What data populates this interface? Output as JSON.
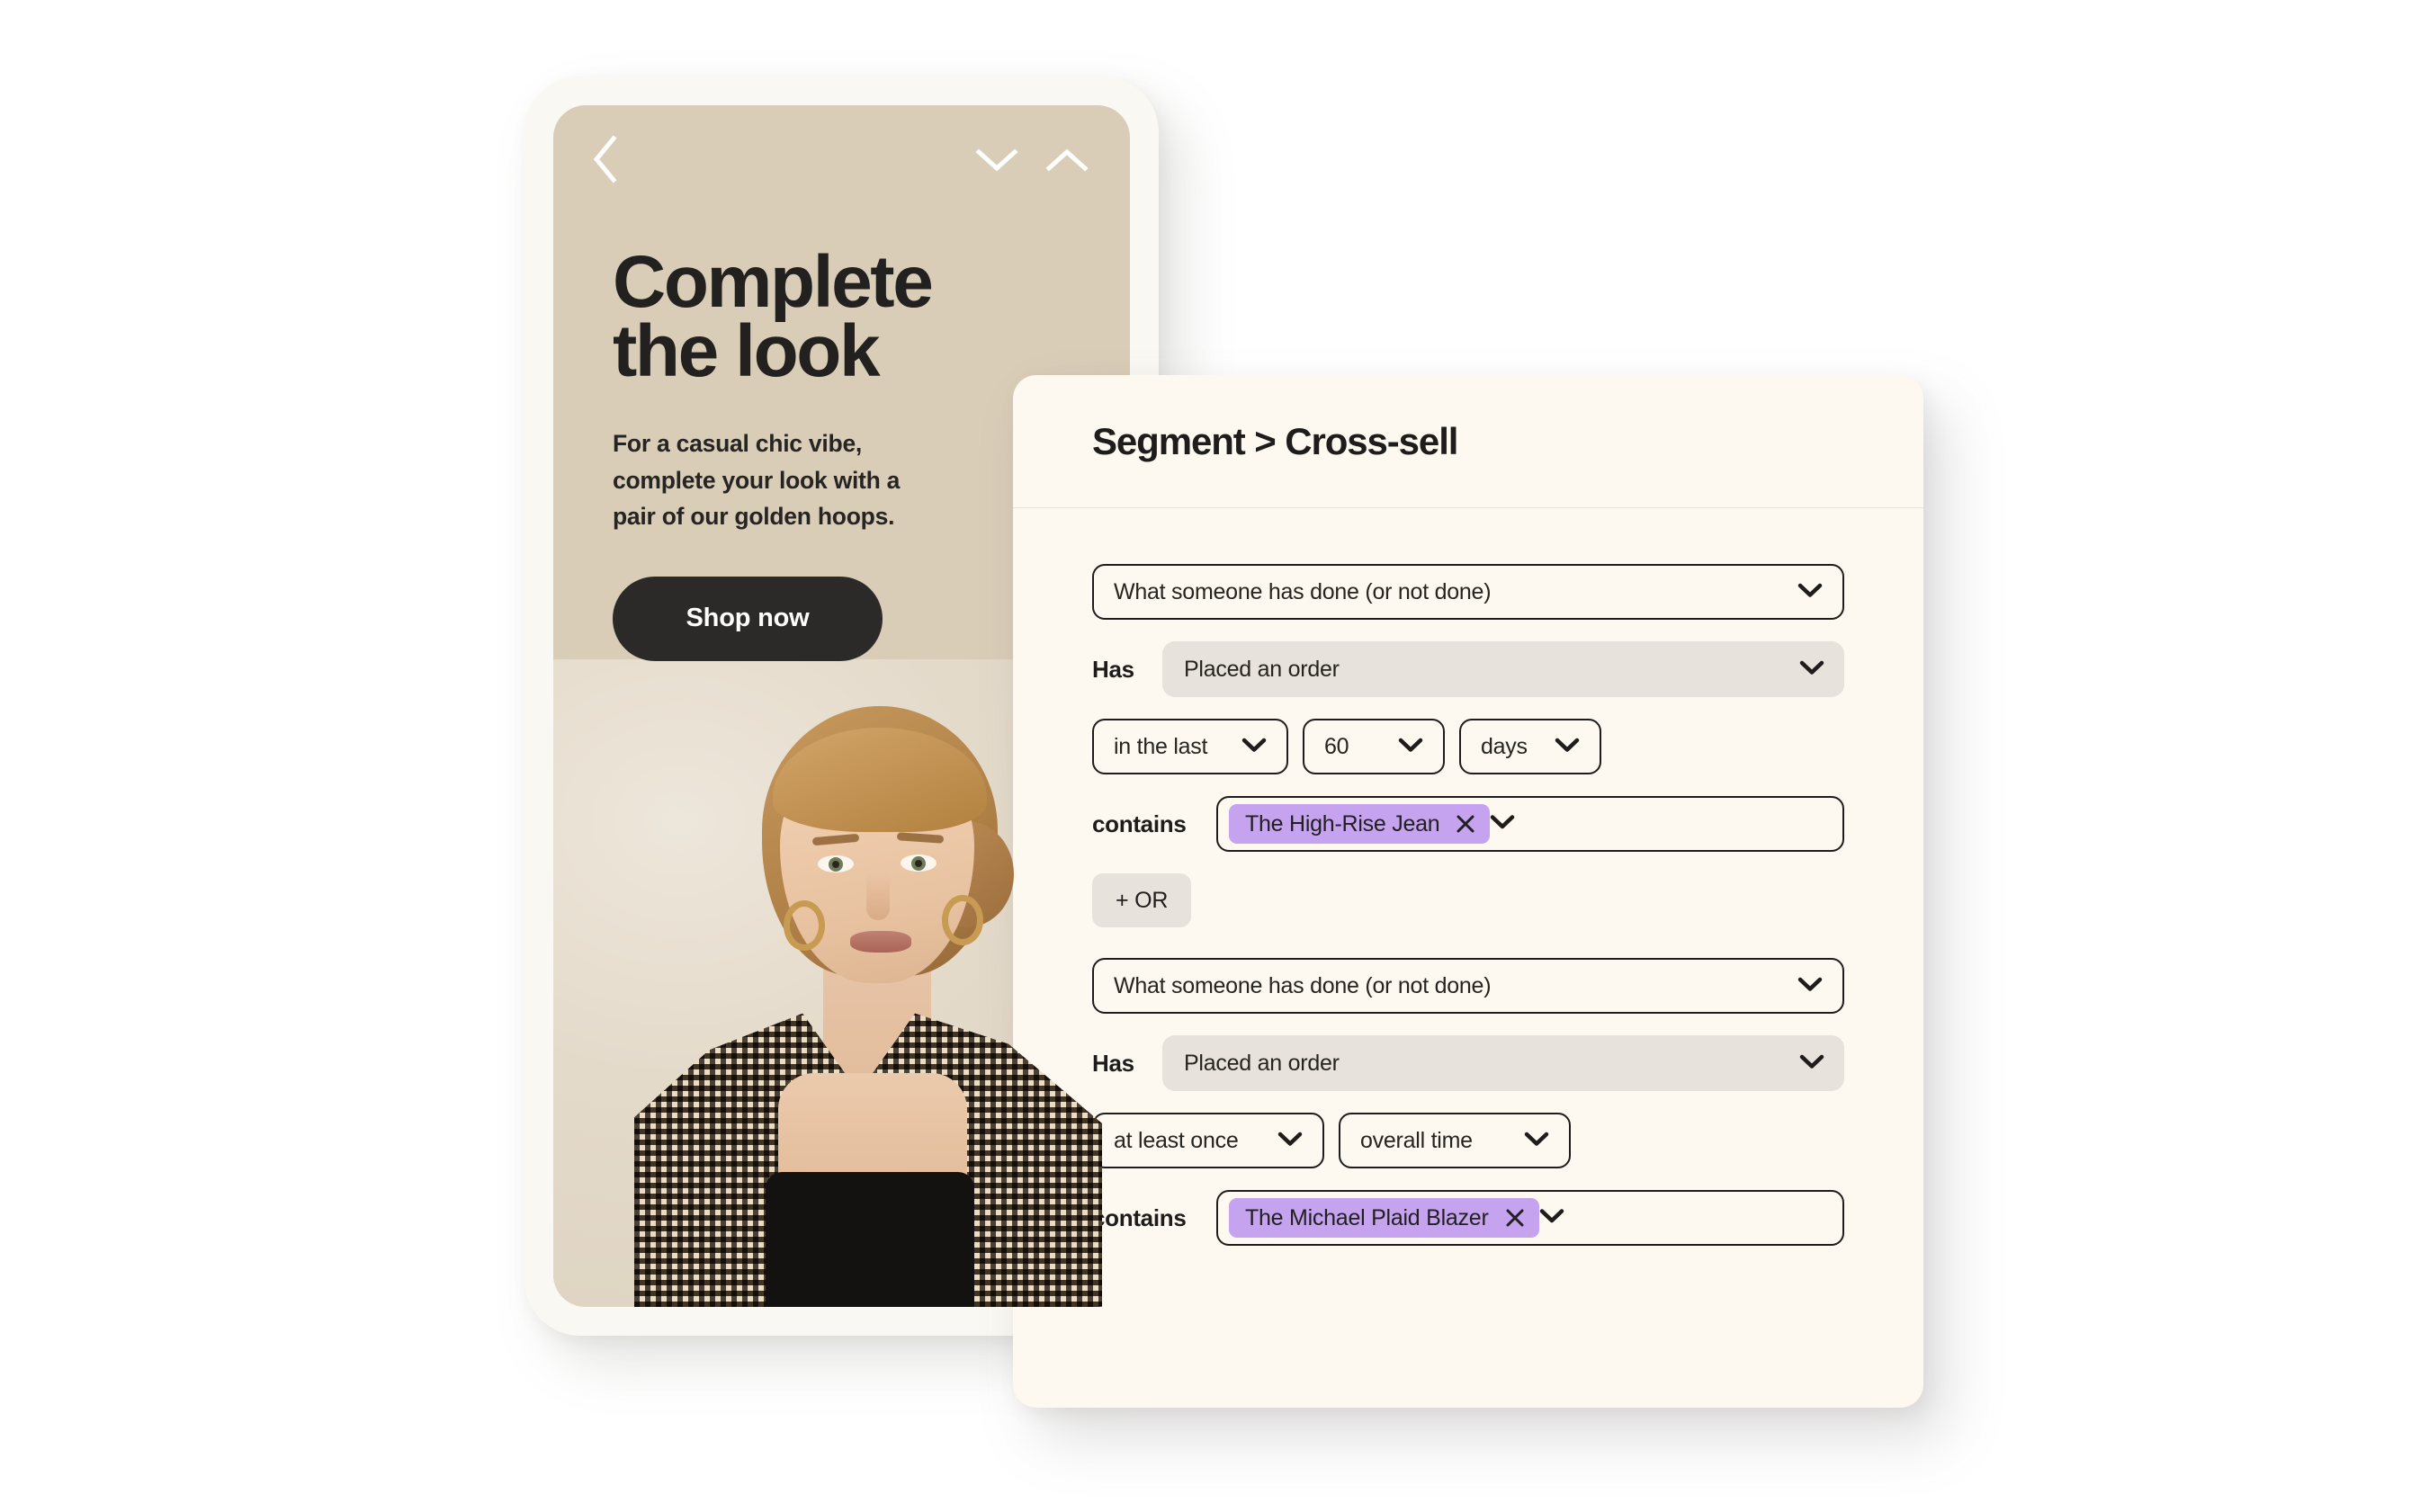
{
  "page": {
    "background": "#FFFFFF"
  },
  "phone": {
    "frame_color": "#FAF8F2",
    "screen_background": "#D9CDB8",
    "topbar": {
      "back_icon": "chevron-left-icon",
      "down_icon": "chevron-down-icon",
      "up_icon": "chevron-up-icon"
    },
    "headline": "Complete\nthe look",
    "subcopy": "For a casual chic vibe,\ncomplete your look with a\npair of our golden hoops.",
    "cta_label": "Shop now",
    "cta_background": "#2B2A28",
    "cta_text_color": "#FFFFFF",
    "photo_alt": "Model with blonde updo hair wearing gold hoop earrings, a brown houndstooth blazer and a black top"
  },
  "card": {
    "background": "#FDF9F0",
    "title": "Segment > Cross-sell",
    "accent_chip_color": "#C6A3EF",
    "grey_field_color": "#E7E3DC",
    "border_color": "#1E1D1B",
    "blocks": [
      {
        "condition_select": {
          "value": "What someone has done (or not done)",
          "icon": "chevron-down-icon"
        },
        "has_label": "Has",
        "event_select": {
          "value": "Placed an order",
          "icon": "chevron-down-icon",
          "style": "grey"
        },
        "timeframe": [
          {
            "name": "operator",
            "value": "in the last",
            "icon": "chevron-down-icon"
          },
          {
            "name": "amount",
            "value": "60",
            "icon": "chevron-down-icon"
          },
          {
            "name": "unit",
            "value": "days",
            "icon": "chevron-down-icon"
          }
        ],
        "contains_label": "contains",
        "contains_chips": [
          {
            "label": "The High-Rise Jean",
            "remove_icon": "close-icon"
          }
        ],
        "contains_icon": "chevron-down-icon",
        "or_button_label": "+ OR"
      },
      {
        "condition_select": {
          "value": "What someone has done (or not done)",
          "icon": "chevron-down-icon"
        },
        "has_label": "Has",
        "event_select": {
          "value": "Placed an order",
          "icon": "chevron-down-icon",
          "style": "grey"
        },
        "timeframe": [
          {
            "name": "operator",
            "value": "at least once",
            "icon": "chevron-down-icon"
          },
          {
            "name": "unit",
            "value": "overall time",
            "icon": "chevron-down-icon"
          }
        ],
        "contains_label": "contains",
        "contains_chips": [
          {
            "label": "The Michael Plaid Blazer",
            "remove_icon": "close-icon"
          }
        ],
        "contains_icon": "chevron-down-icon"
      }
    ]
  }
}
